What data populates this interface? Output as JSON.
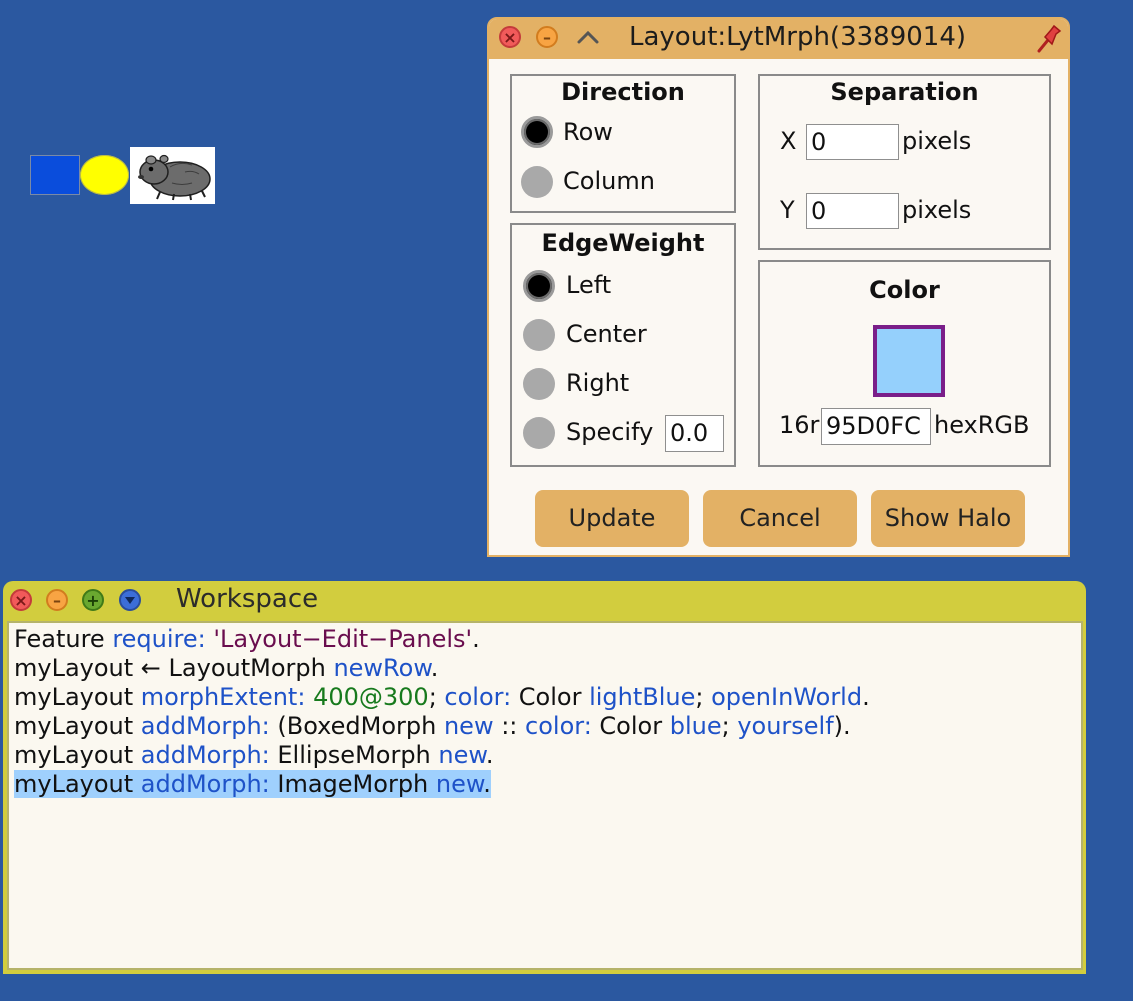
{
  "colors": {
    "desktop": "#2b58a0",
    "layout_morph": "#95d0fc",
    "boxed_morph": "#0a4ddc",
    "ellipse_morph": "#ffff00",
    "editor_title_bar": "#e3b165",
    "workspace_title_bar": "#d2cd3e",
    "selection": "#9fd0fd"
  },
  "layout_editor": {
    "title": "Layout:LytMrph(3389014)",
    "direction": {
      "title": "Direction",
      "options": [
        "Row",
        "Column"
      ],
      "selected": "Row"
    },
    "separation": {
      "title": "Separation",
      "x_label": "X",
      "x_value": "0",
      "y_label": "Y",
      "y_value": "0",
      "unit": "pixels"
    },
    "edge_weight": {
      "title": "EdgeWeight",
      "options": [
        "Left",
        "Center",
        "Right",
        "Specify"
      ],
      "selected": "Left",
      "specify_value": "0.0"
    },
    "color": {
      "title": "Color",
      "radix_prefix": "16r",
      "hex_value": "95D0FC",
      "hex_label": "hexRGB"
    },
    "buttons": {
      "update": "Update",
      "cancel": "Cancel",
      "show_halo": "Show Halo"
    }
  },
  "workspace": {
    "title": "Workspace",
    "lines": [
      [
        {
          "t": "Feature ",
          "c": "plain"
        },
        {
          "t": "require:",
          "c": "kw"
        },
        {
          "t": " ",
          "c": "plain"
        },
        {
          "t": "'Layout−Edit−Panels'",
          "c": "str"
        },
        {
          "t": ".",
          "c": "plain"
        }
      ],
      [
        {
          "t": "myLayout ← LayoutMorph ",
          "c": "plain"
        },
        {
          "t": "newRow",
          "c": "kw"
        },
        {
          "t": ".",
          "c": "plain"
        }
      ],
      [
        {
          "t": "myLayout ",
          "c": "plain"
        },
        {
          "t": "morphExtent:",
          "c": "kw"
        },
        {
          "t": " ",
          "c": "plain"
        },
        {
          "t": "400@300",
          "c": "num"
        },
        {
          "t": "; ",
          "c": "plain"
        },
        {
          "t": "color:",
          "c": "kw"
        },
        {
          "t": " Color ",
          "c": "plain"
        },
        {
          "t": "lightBlue",
          "c": "kw"
        },
        {
          "t": "; ",
          "c": "plain"
        },
        {
          "t": "openInWorld",
          "c": "kw"
        },
        {
          "t": ".",
          "c": "plain"
        }
      ],
      [
        {
          "t": "myLayout ",
          "c": "plain"
        },
        {
          "t": "addMorph:",
          "c": "kw"
        },
        {
          "t": " (BoxedMorph ",
          "c": "plain"
        },
        {
          "t": "new",
          "c": "kw"
        },
        {
          "t": " :: ",
          "c": "plain"
        },
        {
          "t": "color:",
          "c": "kw"
        },
        {
          "t": " Color ",
          "c": "plain"
        },
        {
          "t": "blue",
          "c": "kw"
        },
        {
          "t": "; ",
          "c": "plain"
        },
        {
          "t": "yourself",
          "c": "kw"
        },
        {
          "t": ").",
          "c": "plain"
        }
      ],
      [
        {
          "t": "myLayout ",
          "c": "plain"
        },
        {
          "t": "addMorph:",
          "c": "kw"
        },
        {
          "t": " EllipseMorph ",
          "c": "plain"
        },
        {
          "t": "new",
          "c": "kw"
        },
        {
          "t": ".",
          "c": "plain"
        }
      ],
      [
        {
          "t": "myLayout ",
          "c": "plain"
        },
        {
          "t": "addMorph:",
          "c": "kw"
        },
        {
          "t": " ImageMorph ",
          "c": "plain"
        },
        {
          "t": "new",
          "c": "kw"
        },
        {
          "t": ".",
          "c": "plain"
        }
      ]
    ],
    "selected_line": 5
  }
}
